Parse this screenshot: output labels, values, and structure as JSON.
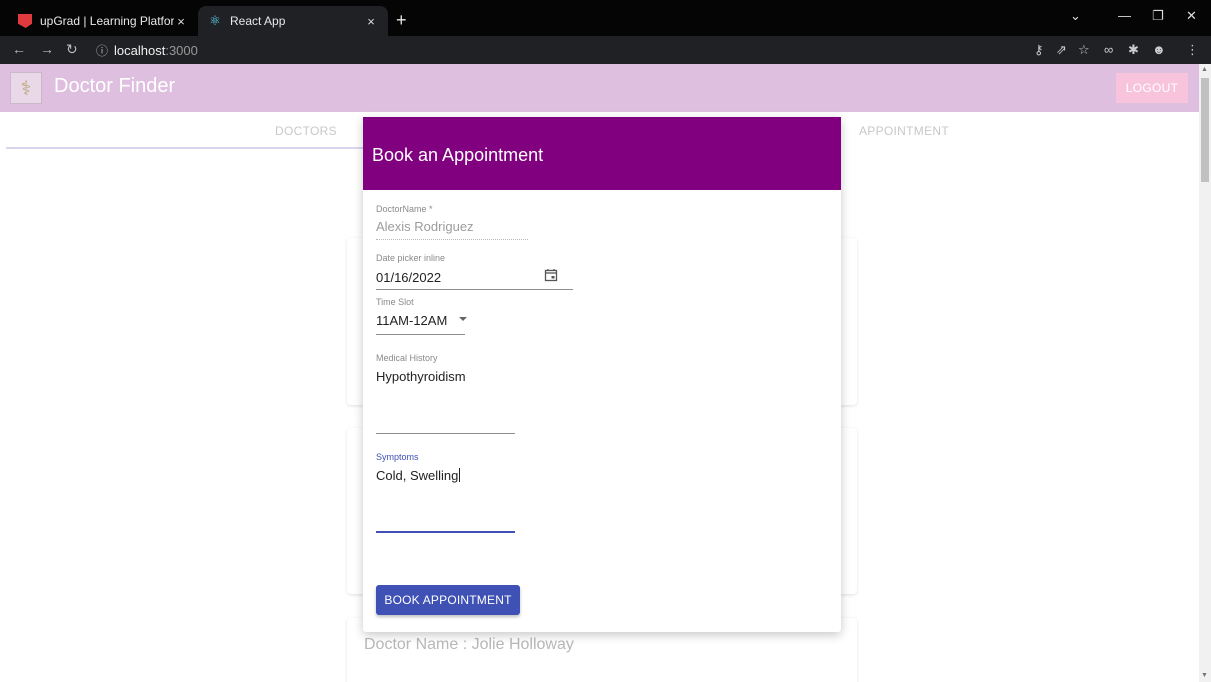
{
  "browser": {
    "tabs": [
      {
        "title": "upGrad | Learning Platform"
      },
      {
        "title": "React App"
      }
    ],
    "new_tab_glyph": "+",
    "close_glyph": "×",
    "address": {
      "host": "localhost",
      "port": ":3000"
    }
  },
  "app": {
    "title": "Doctor Finder",
    "logout_label": "LOGOUT",
    "tabs": [
      {
        "label": "DOCTORS"
      },
      {
        "label": "APPOINTMENT"
      }
    ],
    "background_cards": [
      {
        "text": "Doctor Name : Jolie Holloway"
      }
    ]
  },
  "modal": {
    "title": "Book an Appointment",
    "doctor_name": {
      "label": "DoctorName *",
      "value": "Alexis Rodriguez"
    },
    "date": {
      "label": "Date picker inline",
      "value": "01/16/2022"
    },
    "time_slot": {
      "label": "Time Slot",
      "value": "11AM-12AM"
    },
    "medical_history": {
      "label": "Medical History",
      "value": "Hypothyroidism"
    },
    "symptoms": {
      "label": "Symptoms",
      "value": "Cold, Swelling"
    },
    "book_label": "BOOK APPOINTMENT"
  },
  "colors": {
    "modal_header": "#800080",
    "appbar": "#dfbfdf",
    "primary_button": "#3f51b5",
    "logout_button": "#f8c4dc"
  }
}
